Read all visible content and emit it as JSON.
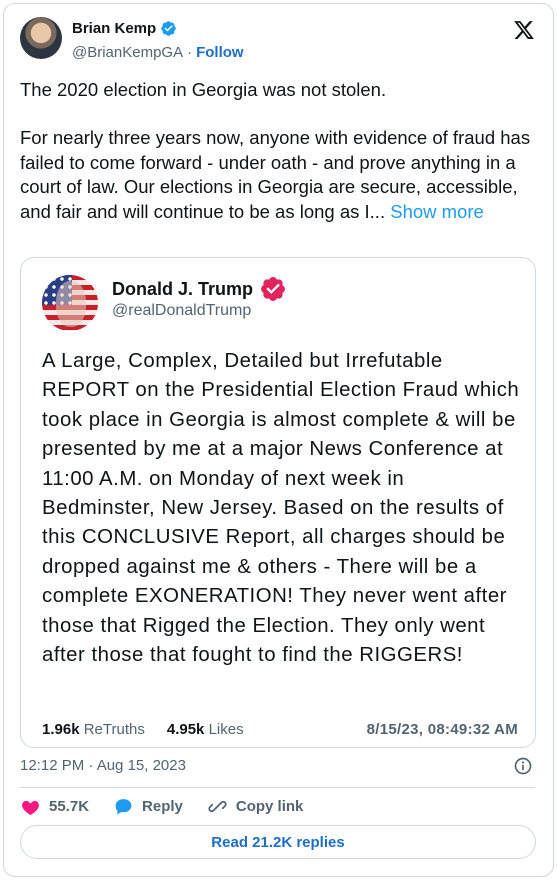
{
  "author": {
    "name": "Brian Kemp",
    "handle": "@BrianKempGA",
    "separator": "·",
    "follow_label": "Follow"
  },
  "tweet": {
    "paragraph1": "The 2020 election in Georgia was not stolen.",
    "paragraph2": "For nearly three years now, anyone with evidence of fraud has failed to come forward - under oath - and prove anything in a court of law. Our elections in Georgia are secure, accessible, and fair and will continue to be as long as I...",
    "show_more": " Show more"
  },
  "quote": {
    "name": "Donald J. Trump",
    "handle": "@realDonaldTrump",
    "text": "A Large, Complex, Detailed but Irrefutable REPORT on the Presidential Election Fraud which took place in Georgia is almost complete & will be presented by me at a major News Conference at 11:00 A.M. on Monday of next week in Bedminster, New Jersey. Based on the results of this CONCLUSIVE Report, all charges should be dropped against me & others - There will be a complete EXONERATION! They never went after those that Rigged the Election. They only went after those that fought to find the RIGGERS!",
    "retruths_count": "1.96k",
    "retruths_label": "ReTruths",
    "likes_count": "4.95k",
    "likes_label": "Likes",
    "timestamp": "8/15/23, 08:49:32 AM"
  },
  "meta": {
    "timestamp": "12:12 PM · Aug 15, 2023"
  },
  "actions": {
    "likes_count": "55.7K",
    "reply_label": "Reply",
    "copy_link_label": "Copy link",
    "read_replies_label": "Read 21.2K replies"
  },
  "icons": {
    "heart": "heart-icon",
    "reply": "reply-bubble-icon",
    "copy_link": "link-icon",
    "info": "info-icon",
    "brand": "x-logo-icon",
    "verified": "verified-badge-icon"
  },
  "colors": {
    "accent_blue": "#1d9bf0",
    "link_blue": "#1d6fc4",
    "heart_pink": "#f91880",
    "truth_badge_red": "#e0245e",
    "muted_text": "#536471",
    "border": "#cfd9de"
  }
}
